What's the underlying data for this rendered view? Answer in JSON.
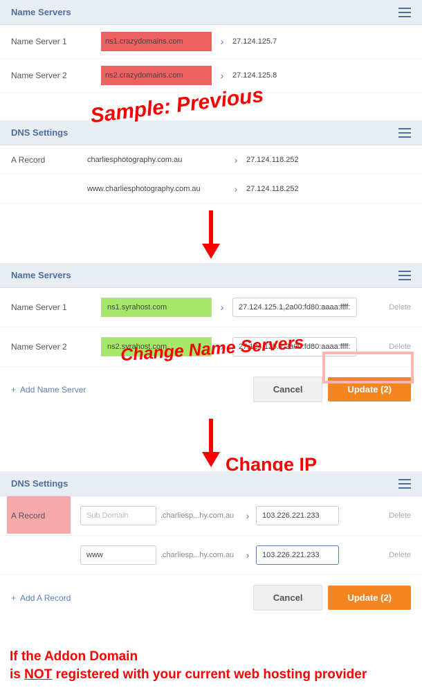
{
  "panel1": {
    "title": "Name Servers",
    "rows": [
      {
        "label": "Name Server 1",
        "value": "ns1.crazydomains.com",
        "ip": "27.124.125.7"
      },
      {
        "label": "Name Server 2",
        "value": "ns2.crazydomains.com",
        "ip": "27.124.125.8"
      }
    ]
  },
  "overlay1": "Sample: Previous",
  "panel2": {
    "title": "DNS Settings",
    "rows": [
      {
        "label": "A Record",
        "value": "charliesphotography.com.au",
        "ip": "27.124.118.252"
      },
      {
        "label": "",
        "value": "www.charliesphotography.com.au",
        "ip": "27.124.118.252"
      }
    ]
  },
  "panel3": {
    "title": "Name Servers",
    "rows": [
      {
        "label": "Name Server 1",
        "value": "ns1.syrahost.com",
        "ip": "27.124.125.1,2a00:fd80:aaaa:ffff:",
        "delete": "Delete"
      },
      {
        "label": "Name Server 2",
        "value": "ns2.syrahost.com",
        "ip": "27.124.125.2,2a00:fd80:aaaa:ffff:",
        "delete": "Delete"
      }
    ],
    "add": "Add Name Server",
    "cancel": "Cancel",
    "update": "Update (2)"
  },
  "overlay2": "Change Name Servers",
  "overlay3": "Change IP",
  "panel4": {
    "title": "DNS Settings",
    "rows": [
      {
        "label": "A Record",
        "sub_placeholder": "Sub Domain",
        "sub": "",
        "domain": ".charliesp...hy.com.au",
        "ip": "103.226.221.233",
        "delete": "Delete"
      },
      {
        "label": "",
        "sub_placeholder": "",
        "sub": "www",
        "domain": ".charliesp...hy.com.au",
        "ip": "103.226.221.233",
        "delete": "Delete"
      }
    ],
    "add": "Add A Record",
    "cancel": "Cancel",
    "update": "Update (2)"
  },
  "footer": {
    "line1": "If the Addon Domain",
    "line2a": "is ",
    "line2b": "NOT",
    "line2c": " registered with your current web hosting provider"
  }
}
